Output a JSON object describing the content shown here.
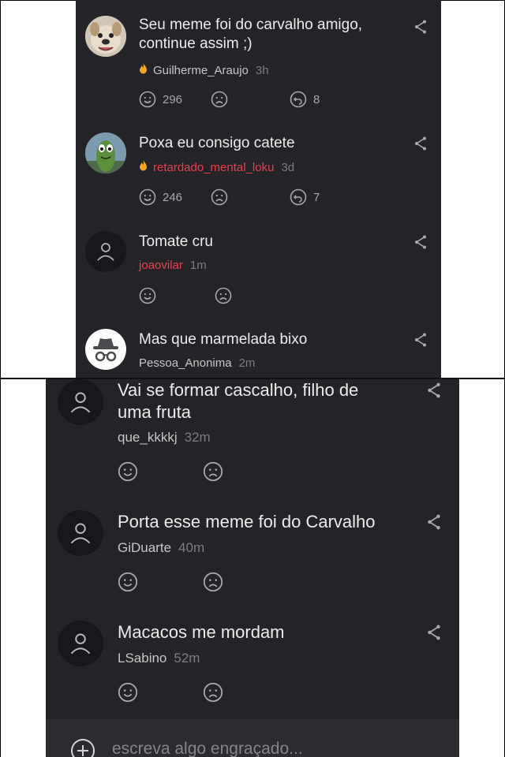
{
  "top_comments": [
    {
      "avatar": "dog-photo",
      "text": "Seu meme foi do carvalho amigo, continue assim ;)",
      "author": "Guilherme_Araujo",
      "author_color": "#c7c7c7",
      "has_fire": true,
      "time": "3h",
      "likes": "296",
      "replies": "8"
    },
    {
      "avatar": "pickle-character",
      "text": "Poxa eu consigo catete",
      "author": "retardado_mental_loku",
      "author_color": "#e8424e",
      "has_fire": true,
      "time": "3d",
      "likes": "246",
      "replies": "7"
    },
    {
      "avatar": "default-user",
      "text": "Tomate cru",
      "author": "joaovilar",
      "author_color": "#e8424e",
      "has_fire": false,
      "time": "1m"
    },
    {
      "avatar": "incognito",
      "text": "Mas que marmelada bixo",
      "author": "Pessoa_Anonima",
      "author_color": "#c7c7c7",
      "has_fire": false,
      "time": "2m"
    }
  ],
  "bottom_comments": [
    {
      "avatar": "default-user",
      "text": "Vai se formar cascalho, filho de uma fruta",
      "author": "que_kkkkj",
      "time": "32m"
    },
    {
      "avatar": "default-user",
      "text": "Porta esse meme foi do Carvalho",
      "author": "GiDuarte",
      "time": "40m"
    },
    {
      "avatar": "default-user",
      "text": "Macacos me mordam",
      "author": "LSabino",
      "time": "52m"
    }
  ],
  "composer": {
    "placeholder": "escreva algo engraçado..."
  },
  "colors": {
    "background": "#242428",
    "text": "#ececec",
    "author_red": "#e8424e",
    "fire": "#f5a623",
    "icon": "#a9a9ae"
  }
}
